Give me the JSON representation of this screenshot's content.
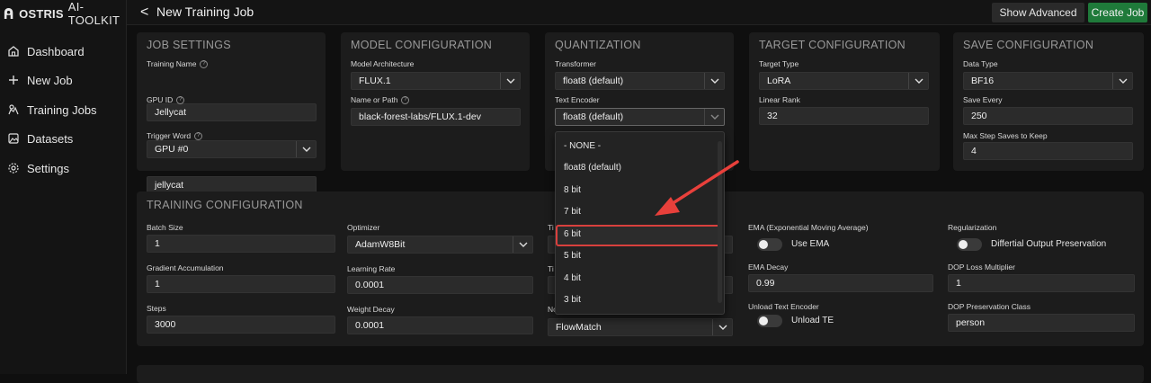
{
  "brand": {
    "name": "OSTRIS",
    "sub": "AI-TOOLKIT"
  },
  "sidebar": {
    "items": [
      {
        "label": "Dashboard",
        "icon": "home-icon"
      },
      {
        "label": "New Job",
        "icon": "plus-icon"
      },
      {
        "label": "Training Jobs",
        "icon": "training-icon"
      },
      {
        "label": "Datasets",
        "icon": "image-icon"
      },
      {
        "label": "Settings",
        "icon": "gear-icon"
      }
    ]
  },
  "header": {
    "back": "<",
    "title": "New Training Job",
    "show_advanced": "Show Advanced",
    "create_job": "Create Job"
  },
  "job": {
    "title": "JOB SETTINGS",
    "training_name_label": "Training Name",
    "training_name": "Jellycat",
    "gpu_label": "GPU ID",
    "gpu": "GPU #0",
    "trigger_label": "Trigger Word",
    "trigger": "jellycat"
  },
  "model": {
    "title": "MODEL CONFIGURATION",
    "arch_label": "Model Architecture",
    "arch": "FLUX.1",
    "path_label": "Name or Path",
    "path": "black-forest-labs/FLUX.1-dev"
  },
  "quant": {
    "title": "QUANTIZATION",
    "transformer_label": "Transformer",
    "transformer": "float8 (default)",
    "text_encoder_label": "Text Encoder",
    "text_encoder": "float8 (default)",
    "options": [
      "- NONE -",
      "float8 (default)",
      "8 bit",
      "7 bit",
      "6 bit",
      "5 bit",
      "4 bit",
      "3 bit"
    ],
    "highlighted": "6 bit"
  },
  "target": {
    "title": "TARGET CONFIGURATION",
    "type_label": "Target Type",
    "type": "LoRA",
    "rank_label": "Linear Rank",
    "rank": "32"
  },
  "save": {
    "title": "SAVE CONFIGURATION",
    "dtype_label": "Data Type",
    "dtype": "BF16",
    "every_label": "Save Every",
    "every": "250",
    "max_label": "Max Step Saves to Keep",
    "max": "4"
  },
  "training": {
    "title": "TRAINING CONFIGURATION",
    "batch_label": "Batch Size",
    "batch": "1",
    "grad_label": "Gradient Accumulation",
    "grad": "1",
    "steps_label": "Steps",
    "steps": "3000",
    "optimizer_label": "Optimizer",
    "optimizer": "AdamW8Bit",
    "lr_label": "Learning Rate",
    "lr": "0.0001",
    "wd_label": "Weight Decay",
    "wd": "0.0001",
    "col3_a_label": "Ti",
    "col3_b_label": "Ti",
    "col3_c_label": "No",
    "noise": "FlowMatch",
    "ema_label": "EMA (Exponential Moving Average)",
    "use_ema": "Use EMA",
    "ema_decay_label": "EMA Decay",
    "ema_decay": "0.99",
    "unload_label": "Unload Text Encoder",
    "unload_te": "Unload TE",
    "reg_label": "Regularization",
    "dop": "Differtial Output Preservation",
    "dop_mult_label": "DOP Loss Multiplier",
    "dop_mult": "1",
    "dop_class_label": "DOP Preservation Class",
    "dop_class": "person"
  },
  "colors": {
    "accent_green": "#1f7a3a",
    "highlight_red": "#d9403d"
  }
}
